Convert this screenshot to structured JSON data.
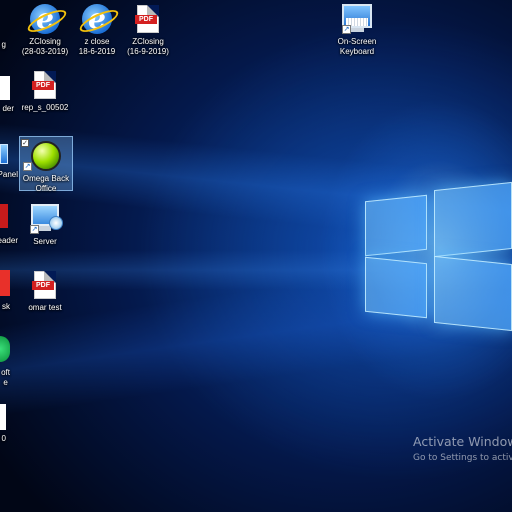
{
  "desktop": {
    "row1_left_label": "g",
    "icons": [
      {
        "label": "ZClosing\n(28-03-2019)",
        "kind": "ie"
      },
      {
        "label": "z close\n18-6-2019",
        "kind": "ie"
      },
      {
        "label": "ZClosing\n(16-9-2019)",
        "kind": "pdf"
      },
      {
        "label": "On-Screen\nKeyboard",
        "kind": "keyboard"
      },
      {
        "label": "rep_s_00502",
        "kind": "pdf"
      },
      {
        "label": "Omega Back\nOffice",
        "kind": "omega"
      },
      {
        "label": "Server",
        "kind": "server"
      },
      {
        "label": "omar test",
        "kind": "pdf"
      }
    ],
    "edge_labels": [
      "der",
      "Panel",
      "eader",
      "sk",
      "oft\ne",
      "0"
    ],
    "pdf_badge": "PDF"
  },
  "watermark": {
    "line1": "Activate Window",
    "line2": "Go to Settings to activ"
  },
  "colors": {
    "background_dark": "#010616",
    "background_mid": "#0a3a8c",
    "logo_glow": "#78c8ff",
    "pdf_red": "#d42020"
  },
  "icons": {
    "ie": "internet-explorer-icon",
    "pdf": "pdf-document-icon",
    "keyboard": "on-screen-keyboard-icon",
    "omega": "omega-app-icon",
    "server": "remote-desktop-icon"
  }
}
